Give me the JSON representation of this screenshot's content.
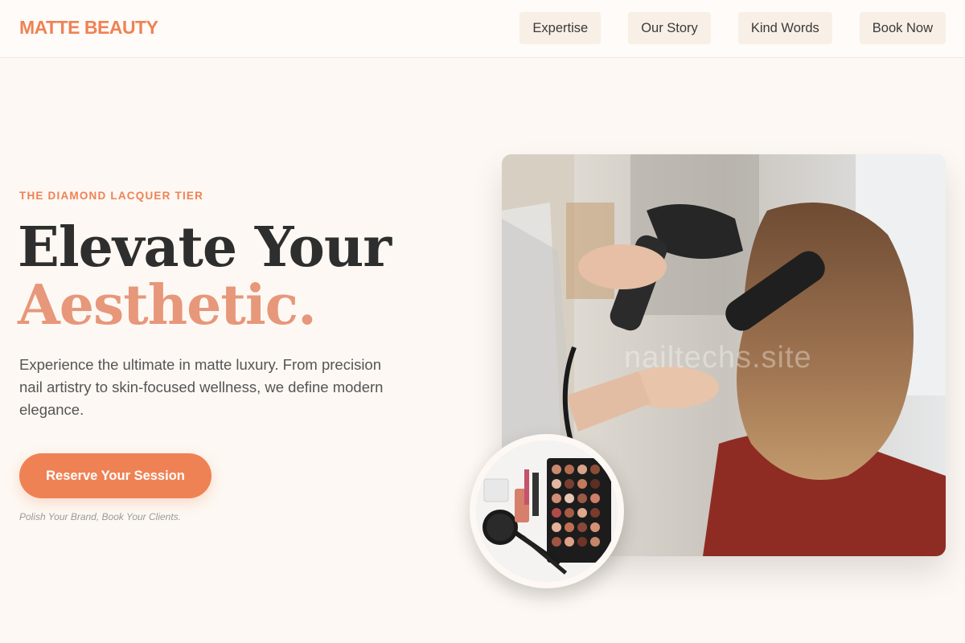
{
  "header": {
    "logo": "MATTE BEAUTY",
    "nav": [
      {
        "label": "Expertise"
      },
      {
        "label": "Our Story"
      },
      {
        "label": "Kind Words"
      },
      {
        "label": "Book Now"
      }
    ]
  },
  "hero": {
    "eyebrow": "THE DIAMOND LACQUER TIER",
    "headline_line1": "Elevate Your",
    "headline_line2": "Aesthetic.",
    "lede": "Experience the ultimate in matte luxury. From precision nail artistry to skin-focused wellness, we define modern elegance.",
    "cta_label": "Reserve Your Session",
    "tagline": "Polish Your Brand, Book Your Clients.",
    "watermark": "nailtechs.site"
  },
  "colors": {
    "accent": "#ef8254",
    "accent_soft": "#e7977a",
    "background": "#fdf8f3",
    "heading": "#2e2e2e"
  },
  "images": {
    "main_photo": "stylist-blow-drying-hair-photo",
    "inset_photo": "makeup-palette-flatlay-photo"
  }
}
